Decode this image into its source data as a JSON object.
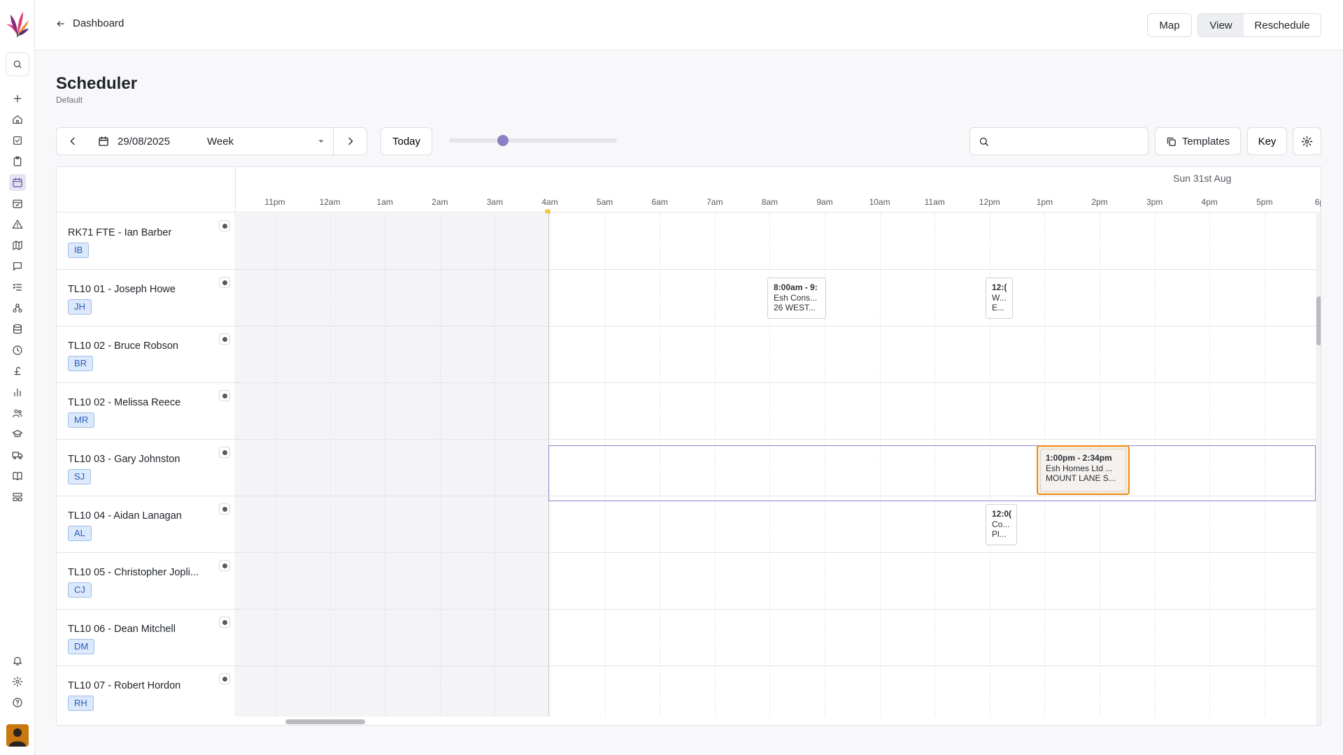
{
  "topbar": {
    "back_label": "Dashboard",
    "map_label": "Map",
    "view_label": "View",
    "reschedule_label": "Reschedule"
  },
  "header": {
    "title": "Scheduler",
    "subtitle": "Default"
  },
  "toolbar": {
    "date_value": "29/08/2025",
    "range_value": "Week",
    "today_label": "Today",
    "zoom_level": 0.3,
    "search_value": "",
    "templates_label": "Templates",
    "key_label": "Key"
  },
  "timeline": {
    "day_label": "Sun 31st Aug",
    "hours": [
      "11pm",
      "12am",
      "1am",
      "2am",
      "3am",
      "4am",
      "5am",
      "6am",
      "7am",
      "8am",
      "9am",
      "10am",
      "11am",
      "12pm",
      "1pm",
      "2pm",
      "3pm",
      "4pm",
      "5pm",
      "6p"
    ]
  },
  "resources": [
    {
      "name": "RK71 FTE - Ian Barber",
      "initials": "IB"
    },
    {
      "name": "TL10 01 - Joseph Howe",
      "initials": "JH"
    },
    {
      "name": "TL10 02 - Bruce Robson",
      "initials": "BR"
    },
    {
      "name": "TL10 02 - Melissa Reece",
      "initials": "MR"
    },
    {
      "name": "TL10 03 - Gary Johnston",
      "initials": "SJ"
    },
    {
      "name": "TL10 04 - Aidan Lanagan",
      "initials": "AL"
    },
    {
      "name": "TL10 05 - Christopher Jopli...",
      "initials": "CJ"
    },
    {
      "name": "TL10 06 - Dean Mitchell",
      "initials": "DM"
    },
    {
      "name": "TL10 07 - Robert Hordon",
      "initials": "RH"
    }
  ],
  "jobs": [
    {
      "row": 1,
      "time": "8:00am - 9:",
      "company": "Esh Cons...",
      "address": "26 WEST..."
    },
    {
      "row": 1,
      "time": "12:(",
      "company": "W...",
      "address": "E..."
    },
    {
      "row": 4,
      "time": "1:00pm - 2:34pm",
      "company": "Esh Homes Ltd ...",
      "address": "MOUNT LANE S...",
      "selected": true
    },
    {
      "row": 5,
      "time": "12:0(",
      "company": "Co...",
      "address": "Pl..."
    }
  ]
}
